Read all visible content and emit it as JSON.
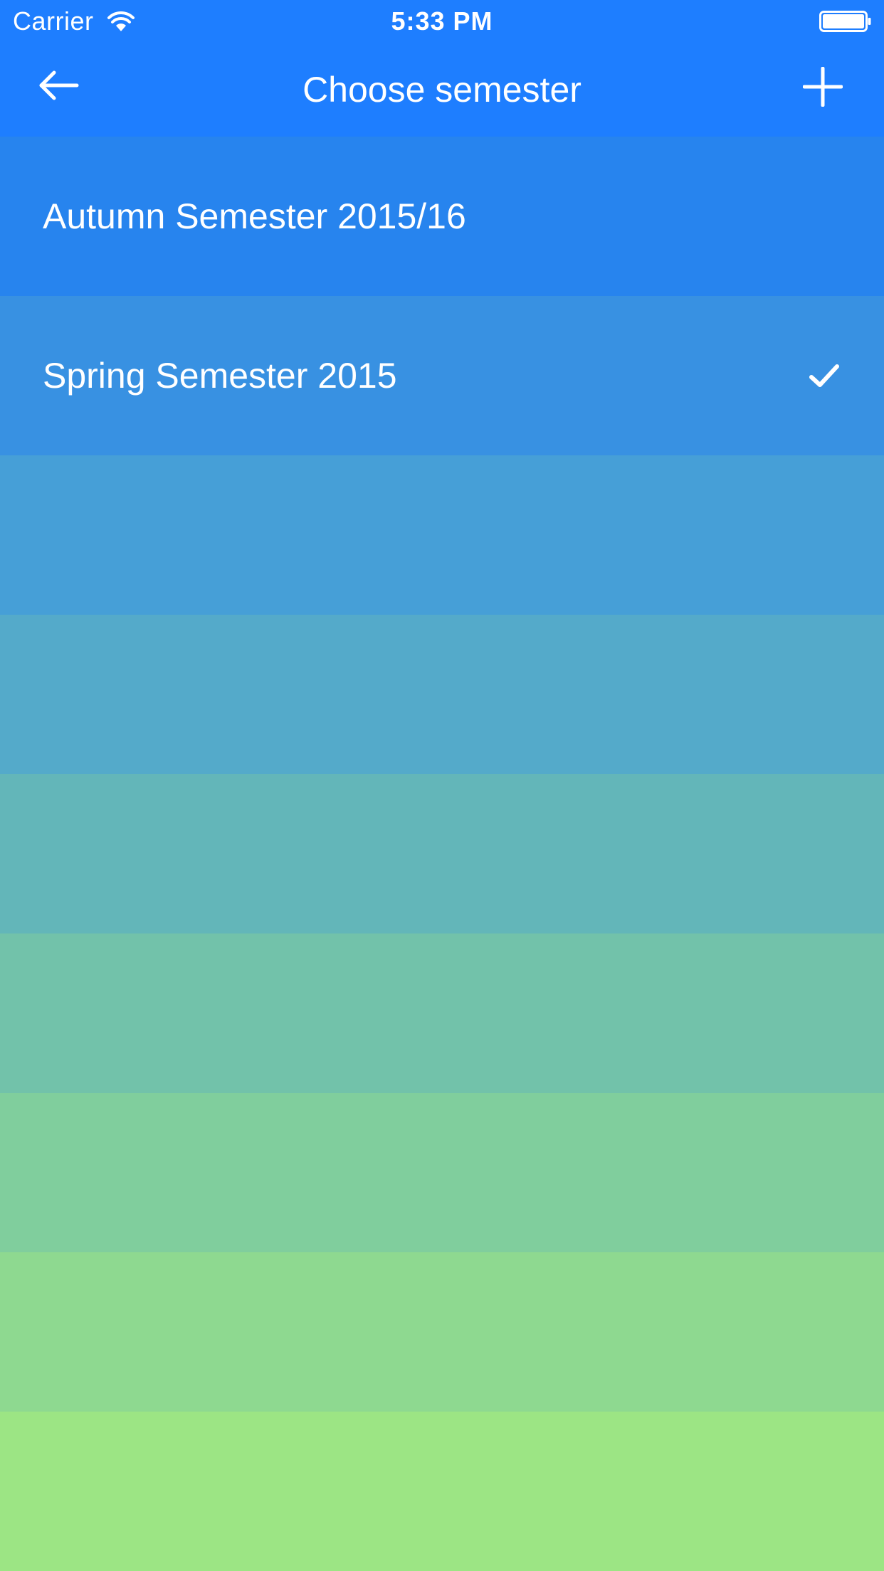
{
  "status_bar": {
    "carrier": "Carrier",
    "time": "5:33 PM",
    "icons": [
      "wifi-icon",
      "battery-icon"
    ]
  },
  "nav": {
    "title": "Choose semester",
    "back_icon": "arrow-left-icon",
    "add_icon": "plus-icon"
  },
  "semesters": [
    {
      "label": "Autumn Semester 2015/16",
      "selected": false,
      "color": "#2784EE"
    },
    {
      "label": "Spring Semester 2015",
      "selected": true,
      "color": "#3891E2"
    },
    {
      "label": "",
      "selected": false,
      "color": "#469FD7"
    },
    {
      "label": "",
      "selected": false,
      "color": "#54AACA"
    },
    {
      "label": "",
      "selected": false,
      "color": "#63B6B9"
    },
    {
      "label": "",
      "selected": false,
      "color": "#72C2AA"
    },
    {
      "label": "",
      "selected": false,
      "color": "#80CE9D"
    },
    {
      "label": "",
      "selected": false,
      "color": "#8ED990"
    },
    {
      "label": "",
      "selected": false,
      "color": "#9CE584"
    }
  ],
  "colors": {
    "header": "#1E7EFF",
    "text": "#FFFFFF"
  }
}
